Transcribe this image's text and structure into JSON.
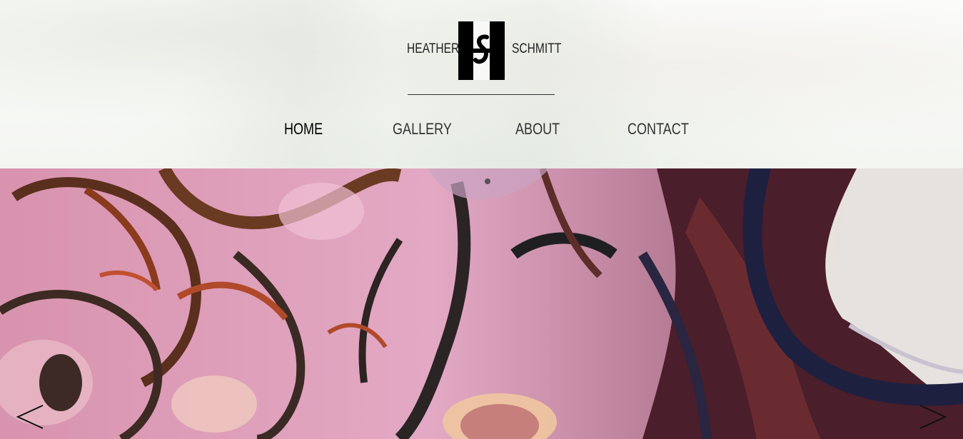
{
  "header": {
    "logo": {
      "first_name": "HEATHER",
      "last_name": "SCHMITT",
      "mark": "HS monogram"
    }
  },
  "nav": {
    "items": [
      {
        "label": "HOME",
        "active": true
      },
      {
        "label": "GALLERY",
        "active": false
      },
      {
        "label": "ABOUT",
        "active": false
      },
      {
        "label": "CONTACT",
        "active": false
      }
    ]
  },
  "slideshow": {
    "image": "abstract painting of pink, brown and navy flower forms",
    "prev_icon": "chevron-left-icon",
    "next_icon": "chevron-right-icon"
  },
  "colors": {
    "text": "#222222",
    "active_nav": "#000000",
    "painting_pink": "#d99ab4",
    "painting_brown": "#6b3a22",
    "painting_navy": "#25233f"
  }
}
